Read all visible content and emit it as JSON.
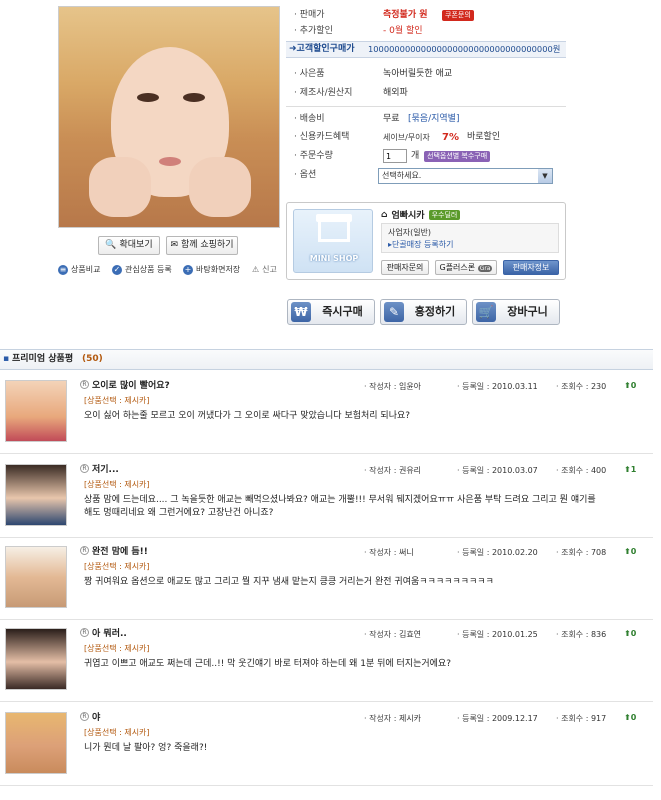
{
  "product": {
    "price_label": "판매가",
    "price_value": "측정불가 원",
    "coupon_badge": "쿠폰문의",
    "extra_discount_label": "추가할인",
    "extra_discount_value": "- 0월 할인",
    "customer_price_label": "고객할인구매가",
    "customer_price_value": "10000000000000000000000000000000000원",
    "gift_label": "사은품",
    "gift_value": "녹아버릴듯한 애교",
    "maker_label": "제조사/원산지",
    "maker_value": "해외파",
    "shipping_label": "배송비",
    "shipping_value": "무료",
    "shipping_option": "[묶음/지역별]",
    "card_label": "신용카드혜택",
    "card_value": "세이브/무이자",
    "card_percent": "7%",
    "card_suffix": "바로할인",
    "qty_label": "주문수량",
    "qty_value": "1",
    "qty_unit": "개",
    "qty_badge": "선택옵션별 복수구매",
    "option_label": "옵션",
    "option_value": "선택하세요."
  },
  "image_buttons": {
    "zoom": "확대보기",
    "shop_together": "함께 쇼핑하기"
  },
  "links": {
    "compare": "상품비교",
    "wish": "관심상품 등록",
    "desktop": "바탕화면저장",
    "report": "신고"
  },
  "shop": {
    "mini_shop": "MINI SHOP",
    "name": "엄빠시카",
    "badge": "우수딜러",
    "type": "사업자(일반)",
    "register": "단골매장 등록하기",
    "ask": "판매자문의",
    "gcredit": "G플러스론",
    "gcredit_tag": "Gra",
    "seller_info": "판매자정보"
  },
  "actions": {
    "buy": "즉시구매",
    "gift": "흥정하기",
    "cart": "장바구니"
  },
  "section": {
    "title": "프리미엄 상품평",
    "count": "(50)"
  },
  "reviews": [
    {
      "title": "오이로 많이 빨어요?",
      "option": "[상품선택 : 제시카]",
      "body": "오이 싫어 하는줄 모르고 오이 꺼냈다가 그 오이로 싸다구 맞았습니다 보험처리 되나요?",
      "author_label": "· 작성자 :",
      "author": "임윤아",
      "date_label": "· 등록일 :",
      "date": "2010.03.11",
      "views_label": "· 조회수 :",
      "views": "230",
      "votes": "0"
    },
    {
      "title": "저기...",
      "option": "[상품선택 : 제시카]",
      "body": "상품 맘에 드는데요.... 그 녹을듯한 애교는 빼먹으셨나봐요? 애교는 개뿔!!! 무서워 뒈지겠어요ㅠㅠ 사은품 부탁 드려요 그리고 뭔 얘기를 해도 멍때리네요 왜 그런거에요? 고장난건 아니죠?",
      "author_label": "· 작성자 :",
      "author": "권유리",
      "date_label": "· 등록일 :",
      "date": "2010.03.07",
      "views_label": "· 조회수 :",
      "views": "400",
      "votes": "1"
    },
    {
      "title": "완전 맘에 듬!!",
      "option": "[상품선택 : 제시카]",
      "body": "짱 귀여워요 옵션으로 애교도 많고 그리고 뭘 지꾸 냄새 맡는지 킁킁 거리는거 완전 귀여움ㅋㅋㅋㅋㅋㅋㅋㅋㅋ",
      "author_label": "· 작성자 :",
      "author": "써니",
      "date_label": "· 등록일 :",
      "date": "2010.02.20",
      "views_label": "· 조회수 :",
      "views": "708",
      "votes": "0"
    },
    {
      "title": "아 뭐러..",
      "option": "[상품선택 : 제시카]",
      "body": "귀엽고 이쁘고 애교도 쩌는데 근데..!! 막 웃긴얘기 바로 터져야 하는데 왜 1분 뒤에 터지는거에요?",
      "author_label": "· 작성자 :",
      "author": "김효연",
      "date_label": "· 등록일 :",
      "date": "2010.01.25",
      "views_label": "· 조회수 :",
      "views": "836",
      "votes": "0"
    },
    {
      "title": "야",
      "option": "[상품선택 : 제시카]",
      "body": "니가 뭔데 날 팔아? 엉? 죽을래?!",
      "author_label": "· 작성자 :",
      "author": "제시카",
      "date_label": "· 등록일 :",
      "date": "2009.12.17",
      "views_label": "· 조회수 :",
      "views": "917",
      "votes": "0"
    }
  ],
  "colors": {
    "accent_red": "#d2291d",
    "link_blue": "#2a5aa8",
    "option_orange": "#b35a10",
    "green_badge": "#5a9a2a"
  }
}
